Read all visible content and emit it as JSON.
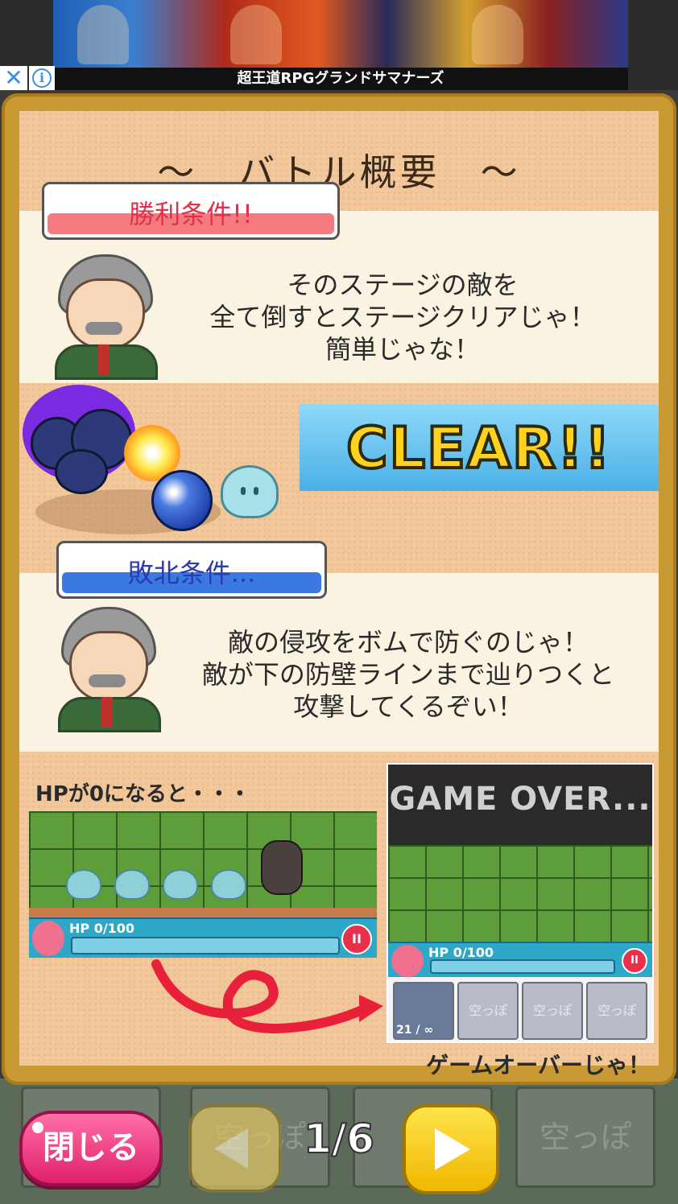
{
  "ad": {
    "title": "超王道RPGグランドサマナーズ",
    "close_icon": "✕",
    "info_icon": "i"
  },
  "board": {
    "heading": "〜　バトル概要　〜",
    "victory": {
      "tab_label": "勝利条件!!",
      "message_lines": [
        "そのステージの敵を",
        "全て倒すとステージクリアじゃ！",
        "簡単じゃな！"
      ],
      "clear_text": "CLEAR!!"
    },
    "defeat": {
      "tab_label": "敗北条件...",
      "message_lines": [
        "敵の侵攻をボムで防ぐのじゃ！",
        "敵が下の防壁ラインまで辿りつくと",
        "攻撃してくるぞい！"
      ]
    },
    "hp_zero_text": "HPが0になると・・・",
    "hp_label_left": "HP 0/100",
    "hp_label_right": "HP 0/100",
    "game_over_title": "GAME OVER...",
    "empty_slot_label": "空っぽ",
    "ammo_label": "21 / ∞",
    "game_over_caption": "ゲームオーバーじゃ！",
    "pause_icon": "II"
  },
  "controls": {
    "close_label": "閉じる",
    "page_indicator": "1/6"
  },
  "background": {
    "slot_label_a": "空っぽ",
    "slot_label_b": "空",
    "slot_label_c": "空っぽ"
  },
  "colors": {
    "victory_accent": "#f07878",
    "defeat_accent": "#3a7ae0",
    "board_frame": "#c99a33"
  }
}
